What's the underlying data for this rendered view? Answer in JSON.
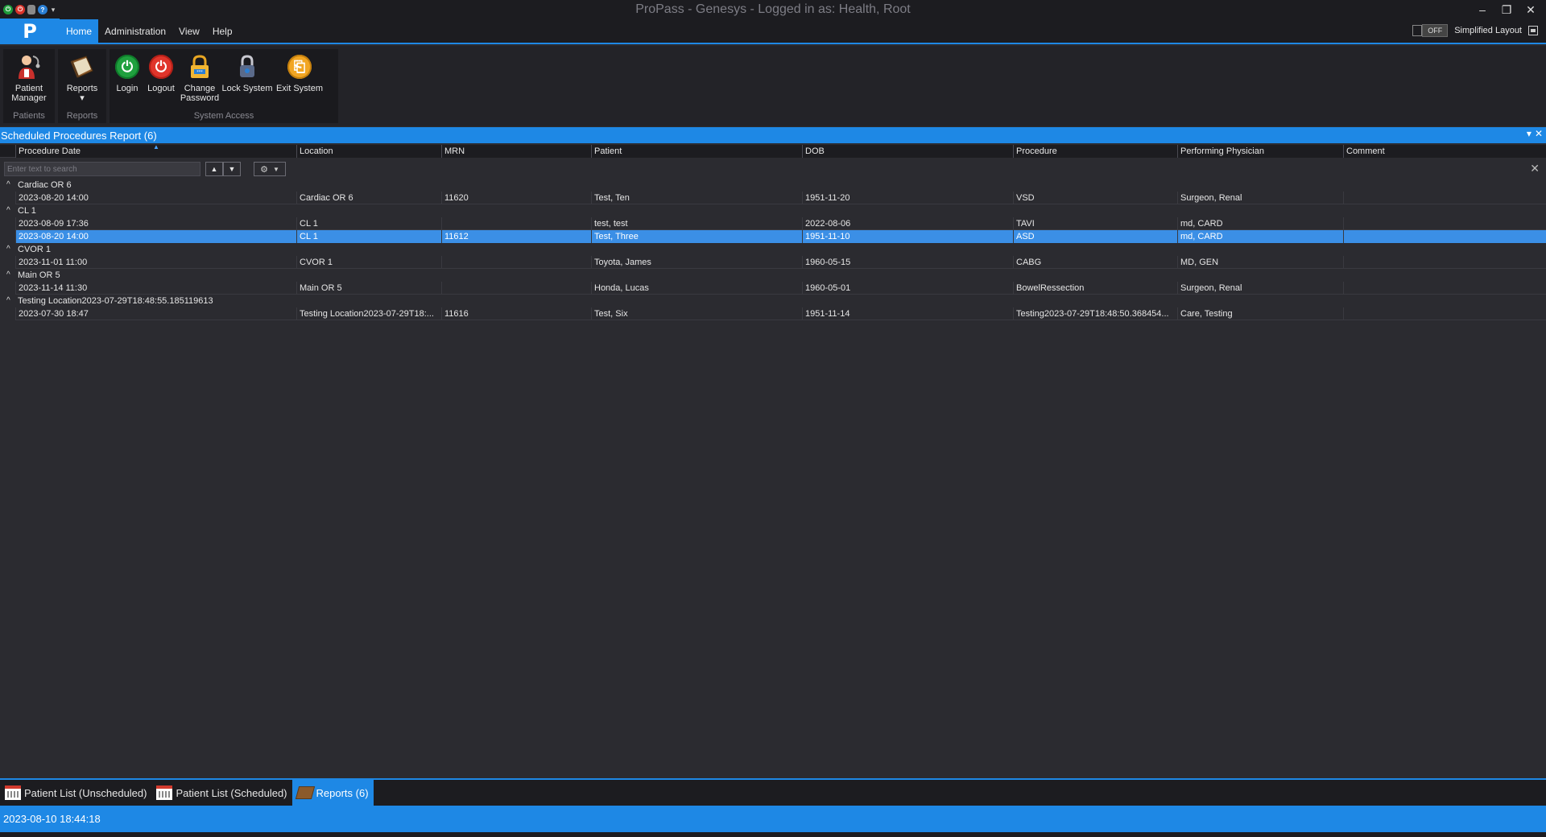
{
  "window": {
    "title": "ProPass - Genesys - Logged in as: Health, Root",
    "controls": {
      "minimize": "–",
      "restore": "❐",
      "close": "✕"
    }
  },
  "menu": {
    "logo": "P",
    "items": [
      "Home",
      "Administration",
      "View",
      "Help"
    ],
    "active": "Home",
    "toggle_label": "OFF",
    "simplified_layout": "Simplified Layout"
  },
  "ribbon": {
    "groups": [
      {
        "label": "Patients",
        "buttons": [
          {
            "label_line1": "Patient",
            "label_line2": "Manager",
            "icon": "patient-manager-icon"
          }
        ]
      },
      {
        "label": "Reports",
        "buttons": [
          {
            "label_line1": "Reports",
            "label_line2": "▾",
            "icon": "reports-book-icon"
          }
        ]
      },
      {
        "label": "System Access",
        "buttons": [
          {
            "label_line1": "Login",
            "label_line2": "",
            "icon": "login-power-icon"
          },
          {
            "label_line1": "Logout",
            "label_line2": "",
            "icon": "logout-power-icon"
          },
          {
            "label_line1": "Change",
            "label_line2": "Password",
            "icon": "change-password-icon"
          },
          {
            "label_line1": "Lock System",
            "label_line2": "",
            "icon": "lock-icon"
          },
          {
            "label_line1": "Exit System",
            "label_line2": "",
            "icon": "exit-icon"
          }
        ]
      }
    ]
  },
  "report": {
    "title": "Scheduled Procedures Report (6)",
    "search_placeholder": "Enter text to search",
    "columns": [
      "Procedure Date",
      "Location",
      "MRN",
      "Patient",
      "DOB",
      "Procedure",
      "Performing Physician",
      "Comment"
    ],
    "groups": [
      {
        "name": "Cardiac OR 6",
        "rows": [
          [
            "2023-08-20 14:00",
            "Cardiac OR 6",
            "11620",
            "Test, Ten",
            "1951-11-20",
            "VSD",
            "Surgeon, Renal",
            ""
          ]
        ]
      },
      {
        "name": "CL 1",
        "rows": [
          [
            "2023-08-09 17:36",
            "CL 1",
            "",
            "test, test",
            "2022-08-06",
            "TAVI",
            "md, CARD",
            ""
          ],
          [
            "2023-08-20 14:00",
            "CL 1",
            "11612",
            "Test, Three",
            "1951-11-10",
            "ASD",
            "md, CARD",
            ""
          ]
        ]
      },
      {
        "name": "CVOR 1",
        "rows": [
          [
            "2023-11-01 11:00",
            "CVOR 1",
            "",
            "Toyota, James",
            "1960-05-15",
            "CABG",
            "MD, GEN",
            ""
          ]
        ]
      },
      {
        "name": "Main OR 5",
        "rows": [
          [
            "2023-11-14 11:30",
            "Main OR 5",
            "",
            "Honda, Lucas",
            "1960-05-01",
            "BowelRessection",
            "Surgeon, Renal",
            ""
          ]
        ]
      },
      {
        "name": "Testing Location2023-07-29T18:48:55.185119613",
        "rows": [
          [
            "2023-07-30 18:47",
            "Testing Location2023-07-29T18:...",
            "11616",
            "Test, Six",
            "1951-11-14",
            "Testing2023-07-29T18:48:50.368454...",
            "Care, Testing",
            ""
          ]
        ]
      }
    ],
    "selected": {
      "group": 1,
      "row": 1
    }
  },
  "bottom_tabs": [
    {
      "label": "Patient List (Unscheduled)",
      "icon": "calendar-icon"
    },
    {
      "label": "Patient List (Scheduled)",
      "icon": "calendar-check-icon"
    },
    {
      "label": "Reports (6)",
      "icon": "reports-book-icon"
    }
  ],
  "active_tab": "Reports (6)",
  "status": {
    "timestamp": "2023-08-10 18:44:18"
  },
  "colors": {
    "accent": "#1e88e5",
    "selected_row": "#3b8fe6",
    "background": "#2b2b30"
  }
}
